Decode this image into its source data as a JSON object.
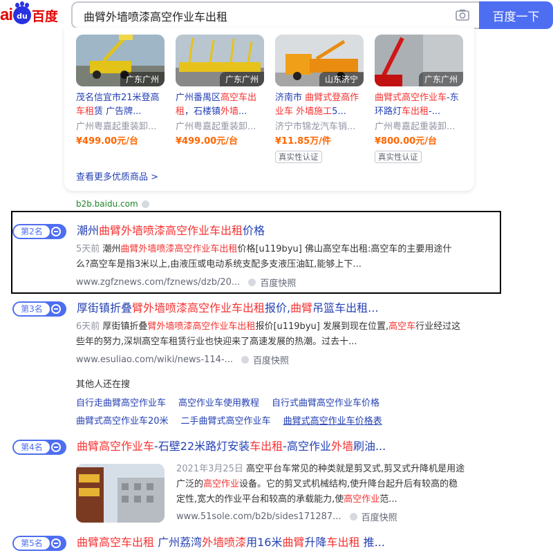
{
  "header": {
    "logo": {
      "left": "ai",
      "paw": "du",
      "right": "百度"
    },
    "search_value": "曲臂外墙喷漆高空作业车出租",
    "search_button": "百度一下"
  },
  "products": {
    "items": [
      {
        "location": "广东广州",
        "title_parts": [
          "茂名信宜市21米登高车租赁 广告牌..."
        ],
        "company": "广州粤嘉起重装卸...",
        "price": "¥499.00元/台",
        "cert": ""
      },
      {
        "location": "广东广州",
        "title_a": "广州番禺区",
        "title_hl": "高空车出租",
        "title_b": "，石楼镇",
        "title_hl2": "外墙",
        "title_c": "...",
        "company": "广州粤嘉起重装卸...",
        "price": "¥499.00元/台",
        "cert": ""
      },
      {
        "location": "山东济宁",
        "title_a": "济南市 ",
        "title_hl": "曲臂式登高作业车",
        "title_b": " ",
        "title_hl2": "外墙施工",
        "title_c": "5...",
        "company": "济宁市锦龙汽车销...",
        "price": "¥11.85万/件",
        "cert": "真实性认证"
      },
      {
        "location": "广东广州",
        "title_a": "",
        "title_hl": "曲臂式高空作业车",
        "title_b": "-东环路灯",
        "title_hl2": "车出租",
        "title_c": "-...",
        "company": "广州粤嘉起重装卸...",
        "price": "¥800.00元/台",
        "cert": "真实性认证"
      }
    ],
    "first_title_a": "茂名信宜市21米登高",
    "first_title_hl": "车租",
    "first_title_b": "赁 广告牌...",
    "more": "查看更多优质商品 >",
    "source": "b2b.baidu.com"
  },
  "results": [
    {
      "rank": "第2名",
      "title_a": "潮州",
      "title_hl": "曲臂外墙喷漆高空作业车出租",
      "title_b": "价格",
      "snippet_time": "5天前",
      "snippet_a": " 潮州",
      "snippet_hl": "曲臂外墙喷漆高空作业车出租",
      "snippet_b": "价格[u119byu] 佛山高空车出租:高空车的主要用途什么?高空车是指3米以上,由液压或电动系统支配多支液压油缸,能够上下...",
      "url": "www.zgfznews.com/fznews/dzb/20...",
      "cache": "百度快照"
    },
    {
      "rank": "第3名",
      "title_a": "厚街镇折叠",
      "title_hl": "臂外墙喷漆高空作业车出租",
      "title_b": "报价,",
      "title_hl2": "曲臂",
      "title_c": "吊篮车出租...",
      "snippet_time": "6天前",
      "snippet_a": " 厚街镇折叠",
      "snippet_hl": "臂外墙喷漆高空作业车出租",
      "snippet_b": "报价[u119byu] 发展到现在位置,",
      "snippet_hl2": "高空车",
      "snippet_c": "行业经过这些年的努力,深圳高空车租赁行业也快迎来了高速发展的热潮。过去十...",
      "url": "www.esuliao.com/wiki/news-114-...",
      "cache": "百度快照"
    },
    {
      "rank": "第4名",
      "title_hl": "曲臂高空作业车",
      "title_a": "-石壁22米路灯安装",
      "title_hl2": "车出租",
      "title_b": "-高空作业",
      "title_hl3": "外墙",
      "title_c": "刷油...",
      "snippet_time": "2021年3月25日",
      "snippet_a": " 高空平台车常见的种类就是剪叉式,剪叉式升降机是用途广泛的",
      "snippet_hl": "高空作业",
      "snippet_b": "设备。它的剪叉式机械结构,使升降台起升后有较高的稳定性,宽大的作业平台和较高的承载能力,使",
      "snippet_hl2": "高空作业",
      "snippet_c": "范...",
      "url": "www.51sole.com/b2b/sides171287...",
      "cache": "百度快照"
    },
    {
      "rank": "第5名",
      "title_hl": "曲臂高空车出租",
      "title_a": " 广州荔湾",
      "title_hl2": "外墙喷漆",
      "title_b": "用16米",
      "title_hl3": "曲臂",
      "title_c": "升降",
      "title_hl4": "车出租",
      "title_d": " 推..."
    }
  ],
  "related": {
    "heading": "其他人还在搜",
    "row1": [
      "自行走曲臂高空作业车",
      "高空作业车使用教程",
      "自行式曲臂高空作业车价格"
    ],
    "row2": [
      "曲臂式高空作业车20米",
      "二手曲臂式高空作业车",
      "曲臂式高空作业车价格表"
    ]
  }
}
